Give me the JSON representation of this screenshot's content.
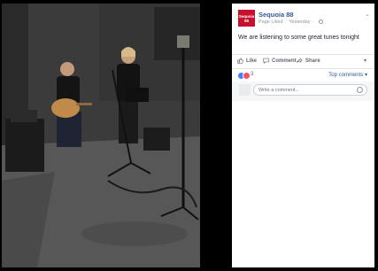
{
  "post": {
    "page_name": "Sequoia 88",
    "logo_text_1": "Sequoia",
    "logo_text_2": "88",
    "status": "Page Liked",
    "time": "Yesterday",
    "text": "We are listening to some great tunes tonight"
  },
  "actions": {
    "like": "Like",
    "comment": "Comment",
    "share": "Share"
  },
  "reactions": {
    "count": "3",
    "top_comments": "Top comments ▾"
  },
  "comment_box": {
    "placeholder": "Write a comment..."
  },
  "colors": {
    "brand": "#c8102e",
    "link": "#365899",
    "like_blue": "#4080ff",
    "love_red": "#f25268"
  }
}
